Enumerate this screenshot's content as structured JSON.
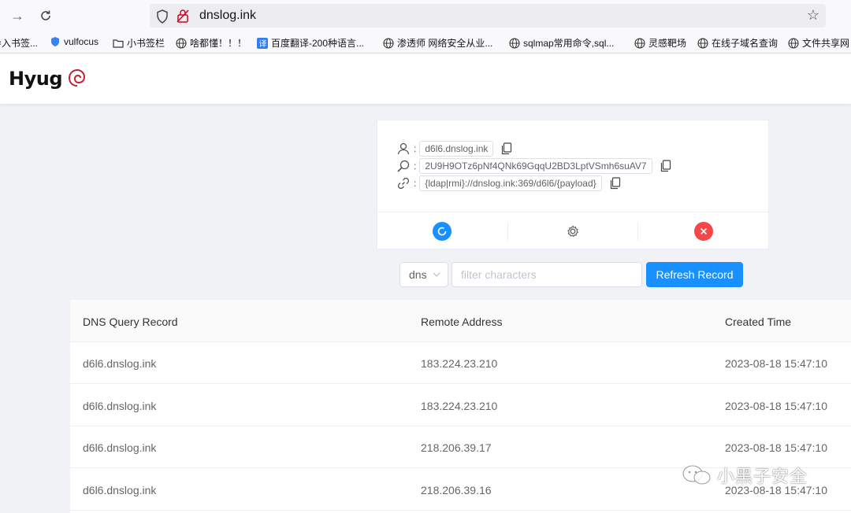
{
  "browser": {
    "url": "dnslog.ink",
    "bookmarks": [
      {
        "label": "导入书签...",
        "icon": "none"
      },
      {
        "label": "vulfocus",
        "icon": "shield-icon"
      },
      {
        "label": "小书签栏",
        "icon": "folder-icon"
      },
      {
        "label": "啥都懂！！！",
        "icon": "globe-icon"
      },
      {
        "label": "百度翻译-200种语言...",
        "icon": "translate-icon"
      },
      {
        "label": "渗透师 网络安全从业...",
        "icon": "globe-icon"
      },
      {
        "label": "sqlmap常用命令,sql...",
        "icon": "globe-icon"
      },
      {
        "label": "灵感靶场",
        "icon": "globe-icon"
      },
      {
        "label": "在线子域名查询",
        "icon": "globe-icon"
      },
      {
        "label": "文件共享网",
        "icon": "globe-icon"
      }
    ]
  },
  "header": {
    "logo": "Hyug"
  },
  "card": {
    "domain": "d6l6.dnslog.ink",
    "token": "2U9H9OTz6pNf4QNk69GqqU2BD3LptVSmh6suAV7",
    "payload": "{ldap|rmi}://dnslog.ink:369/d6l6/{payload}",
    "colors": {
      "primary": "#1890ff",
      "danger": "#f5464a"
    }
  },
  "filter": {
    "type_value": "dns",
    "placeholder": "filter characters",
    "refresh_label": "Refresh Record"
  },
  "table": {
    "headers": [
      "DNS Query Record",
      "Remote Address",
      "Created Time"
    ],
    "rows": [
      {
        "record": "d6l6.dnslog.ink",
        "address": "183.224.23.210",
        "time": "2023-08-18 15:47:10"
      },
      {
        "record": "d6l6.dnslog.ink",
        "address": "183.224.23.210",
        "time": "2023-08-18 15:47:10"
      },
      {
        "record": "d6l6.dnslog.ink",
        "address": "218.206.39.17",
        "time": "2023-08-18 15:47:10"
      },
      {
        "record": "d6l6.dnslog.ink",
        "address": "218.206.39.16",
        "time": "2023-08-18 15:47:10"
      }
    ]
  },
  "watermark": "小黑子安全"
}
